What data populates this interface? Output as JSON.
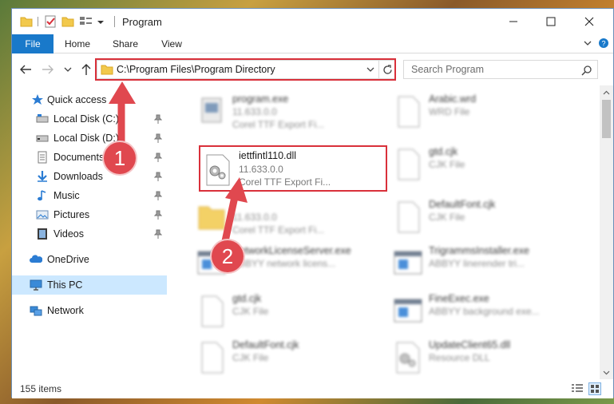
{
  "window": {
    "title": "Program"
  },
  "ribbon": {
    "tabs": [
      "File",
      "Home",
      "Share",
      "View"
    ]
  },
  "address": {
    "path": "C:\\Program Files\\Program Directory",
    "search_placeholder": "Search Program"
  },
  "sidebar": {
    "items": [
      {
        "label": "Quick access",
        "icon": "star-icon",
        "pinned": false
      },
      {
        "label": "Local Disk (C:)",
        "icon": "drive-icon",
        "pinned": true
      },
      {
        "label": "Local Disk (D:)",
        "icon": "drive-icon",
        "pinned": true
      },
      {
        "label": "Documents",
        "icon": "documents-icon",
        "pinned": true
      },
      {
        "label": "Downloads",
        "icon": "downloads-icon",
        "pinned": true
      },
      {
        "label": "Music",
        "icon": "music-icon",
        "pinned": true
      },
      {
        "label": "Pictures",
        "icon": "pictures-icon",
        "pinned": true
      },
      {
        "label": "Videos",
        "icon": "videos-icon",
        "pinned": true
      },
      {
        "label": "OneDrive",
        "icon": "onedrive-icon",
        "pinned": false
      },
      {
        "label": "This PC",
        "icon": "computer-icon",
        "pinned": false,
        "selected": true
      },
      {
        "label": "Network",
        "icon": "network-icon",
        "pinned": false
      }
    ]
  },
  "files": [
    {
      "name": "program.exe",
      "line2": "11.633.0.0",
      "line3": "Corel TTF Export Fi...",
      "icon": "exe-icon"
    },
    {
      "name": "Arabic.wrd",
      "line2": "WRD File",
      "line3": "",
      "icon": "file-icon"
    },
    {
      "name": "iettfintl110.dll",
      "line2": "11.633.0.0",
      "line3": "Corel TTF Export Fi...",
      "icon": "dll-gear-icon",
      "highlighted": true
    },
    {
      "name": "gtd.cjk",
      "line2": "CJK File",
      "line3": "",
      "icon": "file-icon"
    },
    {
      "name": "",
      "line2": "11.633.0.0",
      "line3": "Corel TTF Export Fi...",
      "icon": "folder-icon"
    },
    {
      "name": "DefaultFont.cjk",
      "line2": "CJK File",
      "line3": "",
      "icon": "file-icon"
    },
    {
      "name": "NetworkLicenseServer.exe",
      "line2": "ABBYY network licens...",
      "line3": "",
      "icon": "app-window-icon"
    },
    {
      "name": "TrigrammsInstaller.exe",
      "line2": "ABBYY linerender tri...",
      "line3": "",
      "icon": "app-window-icon"
    },
    {
      "name": "gtd.cjk",
      "line2": "CJK File",
      "line3": "",
      "icon": "file-icon"
    },
    {
      "name": "FineExec.exe",
      "line2": "ABBYY background exe...",
      "line3": "",
      "icon": "app-window-icon"
    },
    {
      "name": "DefaultFont.cjk",
      "line2": "CJK File",
      "line3": "",
      "icon": "file-icon"
    },
    {
      "name": "UpdateClient65.dll",
      "line2": "Resource DLL",
      "line3": "",
      "icon": "dll-gear-icon"
    }
  ],
  "status": {
    "item_count": "155 items"
  },
  "annotations": {
    "badge1": "1",
    "badge2": "2"
  },
  "colors": {
    "accent": "#1979ca",
    "highlight": "#d9303a",
    "badge": "#e0484f",
    "selected": "#cce8ff"
  }
}
